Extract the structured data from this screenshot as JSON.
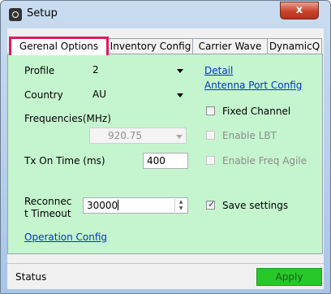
{
  "window": {
    "title": "Setup",
    "close_label": "x"
  },
  "tabs": [
    {
      "label": "Gerenal Options"
    },
    {
      "label": "Inventory Config"
    },
    {
      "label": "Carrier Wave"
    },
    {
      "label": "DynamicQ"
    }
  ],
  "form": {
    "profile_label": "Profile",
    "profile_value": "2",
    "country_label": "Country",
    "country_value": "AU",
    "frequencies_label": "Frequencies(MHz)",
    "frequency_value": "920.75",
    "tx_label": "Tx On Time (ms)",
    "tx_value": "400",
    "reconnect_label_1": "Reconnec",
    "reconnect_label_2": "t Timeout",
    "reconnect_value": "30000",
    "detail_link": "Detail",
    "antenna_link": "Antenna Port Config",
    "operation_link": "Operation Config",
    "fixed_channel": "Fixed Channel",
    "enable_lbt": "Enable LBT",
    "enable_freq_agile": "Enable Freq Agile",
    "save_settings": "Save settings",
    "checkmark": "✓"
  },
  "status": {
    "text": "Status",
    "apply_label": "Apply"
  },
  "colors": {
    "panel": "#c5f5cf",
    "apply": "#28c828",
    "tab_highlight": "#e0185f",
    "link": "#0033cc"
  }
}
